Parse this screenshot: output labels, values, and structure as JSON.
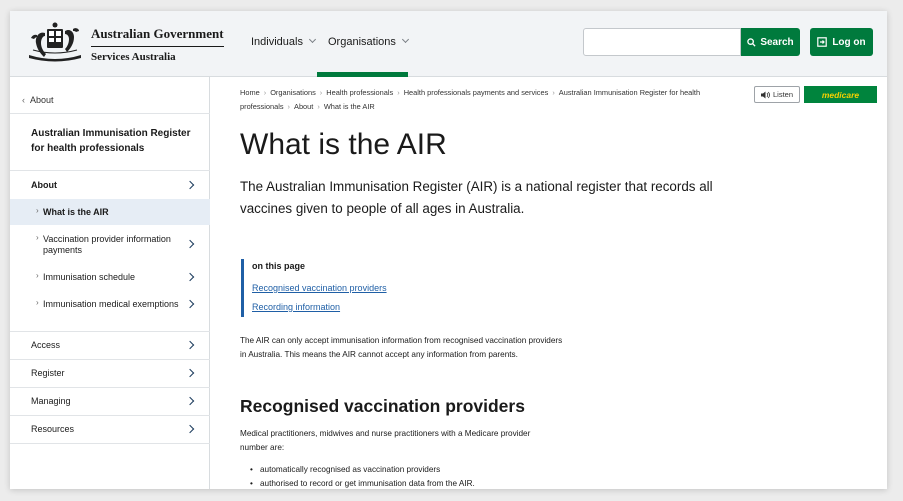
{
  "header": {
    "gov_line1": "Australian Government",
    "gov_line2": "Services Australia",
    "nav": [
      {
        "label": "Individuals"
      },
      {
        "label": "Organisations"
      }
    ],
    "search_placeholder": "",
    "search_label": "Search",
    "login_label": "Log on"
  },
  "sidebar": {
    "back_label": "About",
    "section_title": "Australian Immunisation Register for health professionals",
    "items": [
      {
        "label": "About"
      },
      {
        "label": "What is the AIR"
      },
      {
        "label": "Vaccination provider information payments"
      },
      {
        "label": "Immunisation schedule"
      },
      {
        "label": "Immunisation medical exemptions"
      },
      {
        "label": "Access"
      },
      {
        "label": "Register"
      },
      {
        "label": "Managing"
      },
      {
        "label": "Resources"
      }
    ]
  },
  "breadcrumbs": [
    "Home",
    "Organisations",
    "Health professionals",
    "Health professionals payments and services",
    "Australian Immunisation Register for health professionals",
    "About",
    "What is the AIR"
  ],
  "tools": {
    "listen_label": "Listen",
    "medicare_label": "medicare"
  },
  "content": {
    "title": "What is the AIR",
    "lead": "The Australian Immunisation Register (AIR) is a national register that records all vaccines given to people of all ages in Australia.",
    "on_this_page": {
      "title": "on this page",
      "links": [
        "Recognised vaccination providers",
        "Recording information"
      ]
    },
    "para1": "The AIR can only accept immunisation information from recognised vaccination providers in Australia. This means the AIR cannot accept any information from parents.",
    "section_heading": "Recognised vaccination providers",
    "para2": "Medical practitioners, midwives and nurse practitioners with a Medicare provider number are:",
    "bullets": [
      "automatically recognised as vaccination providers",
      "authorised to record or get immunisation data from the AIR."
    ]
  },
  "colors": {
    "brand_green": "#007a3d",
    "link_blue": "#1f5fa6",
    "medicare_yellow": "#f5d000"
  }
}
